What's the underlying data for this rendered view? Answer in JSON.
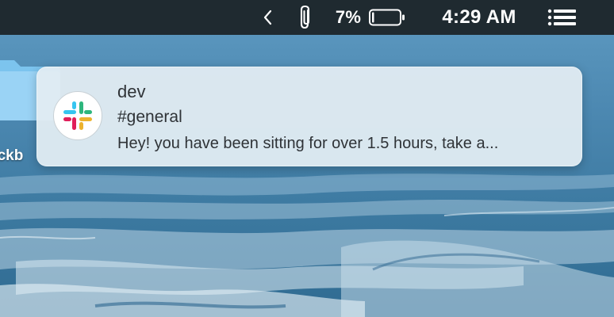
{
  "menubar": {
    "icons": [
      "chevron-left-icon",
      "paperclip-icon",
      "battery-icon",
      "list-icon"
    ],
    "battery_percent": "7%",
    "battery_level": 0.07,
    "clock": "4:29 AM"
  },
  "desktop": {
    "folder_label": "ackb"
  },
  "notification": {
    "app_icon": "slack-logo-icon",
    "title": "dev",
    "subtitle": "#general",
    "body": "Hey! you have been sitting for over 1.5 hours, take a..."
  },
  "colors": {
    "menubar_bg": "#1f2a30",
    "notification_bg": "#e2ecf2",
    "slack_blue": "#36c5f0",
    "slack_green": "#2eb67d",
    "slack_yellow": "#ecb22e",
    "slack_red": "#e01e5a"
  }
}
